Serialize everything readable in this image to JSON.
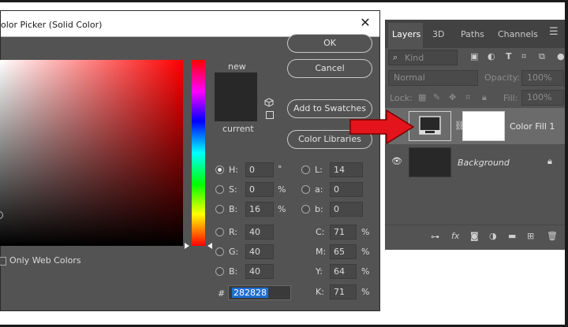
{
  "dialog": {
    "title": "olor Picker (Solid Color)",
    "close_icon": "close-icon",
    "buttons": {
      "ok": "OK",
      "cancel": "Cancel",
      "add_swatches": "Add to Swatches",
      "color_libraries": "Color Libraries"
    },
    "swatch_labels": {
      "new": "new",
      "current": "current"
    },
    "only_web_colors": "Only Web Colors",
    "hsb": [
      {
        "label": "H:",
        "value": "0",
        "unit": "°",
        "selected": true
      },
      {
        "label": "S:",
        "value": "0",
        "unit": "%",
        "selected": false
      },
      {
        "label": "B:",
        "value": "16",
        "unit": "%",
        "selected": false
      }
    ],
    "rgb": [
      {
        "label": "R:",
        "value": "40"
      },
      {
        "label": "G:",
        "value": "40"
      },
      {
        "label": "B:",
        "value": "40"
      }
    ],
    "lab": [
      {
        "label": "L:",
        "value": "14"
      },
      {
        "label": "a:",
        "value": "0"
      },
      {
        "label": "b:",
        "value": "0"
      }
    ],
    "cmyk": [
      {
        "label": "C:",
        "value": "71",
        "unit": "%"
      },
      {
        "label": "M:",
        "value": "65",
        "unit": "%"
      },
      {
        "label": "Y:",
        "value": "64",
        "unit": "%"
      },
      {
        "label": "K:",
        "value": "71",
        "unit": "%"
      }
    ],
    "hex": {
      "label": "#",
      "value": "282828"
    },
    "colors": {
      "new": "#282828",
      "current": "#282828"
    }
  },
  "layers_panel": {
    "tabs": [
      "Layers",
      "3D",
      "Paths",
      "Channels"
    ],
    "active_tab": "Layers",
    "filter_kind": "Kind",
    "blend_mode": "Normal",
    "opacity_label": "Opacity:",
    "opacity_value": "100%",
    "lock_label": "Lock:",
    "fill_label": "Fill:",
    "fill_value": "100%",
    "layers": [
      {
        "name": "Color Fill 1",
        "selected": true
      },
      {
        "name": "Background",
        "italic": true,
        "locked": true
      }
    ]
  },
  "colors": {
    "annotation_arrow": "#e3141b",
    "dialog_bg": "#535353",
    "accent": "#1e6fcf"
  }
}
